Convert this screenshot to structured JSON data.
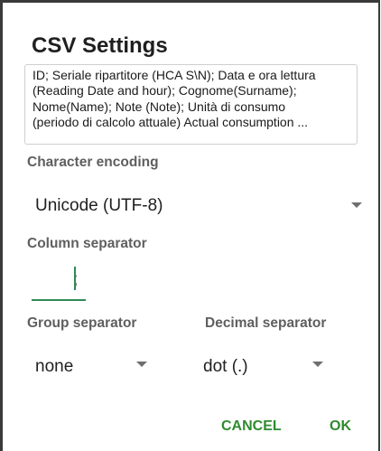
{
  "dialog": {
    "title": "CSV Settings",
    "columns_text": [
      "ID; Seriale ripartitore (HCA S\\N); Data e ora lettura",
      "(Reading Date and hour); Cognome(Surname);",
      "Nome(Name); Note (Note); Unità di consumo",
      "(periodo di calcolo attuale) Actual consumption ..."
    ]
  },
  "character_encoding": {
    "label": "Character encoding",
    "value": "Unicode (UTF-8)"
  },
  "column_separator": {
    "label": "Column separator",
    "value": ";"
  },
  "group_separator": {
    "label": "Group separator",
    "value": "none"
  },
  "decimal_separator": {
    "label": "Decimal separator",
    "value": "dot (.)"
  },
  "buttons": {
    "cancel": "CANCEL",
    "ok": "OK"
  },
  "colors": {
    "accent": "#2e8b2e",
    "label": "#5f5f5f",
    "text": "#1f1f1f"
  },
  "icons": {
    "dropdown": "caret-down-icon"
  }
}
